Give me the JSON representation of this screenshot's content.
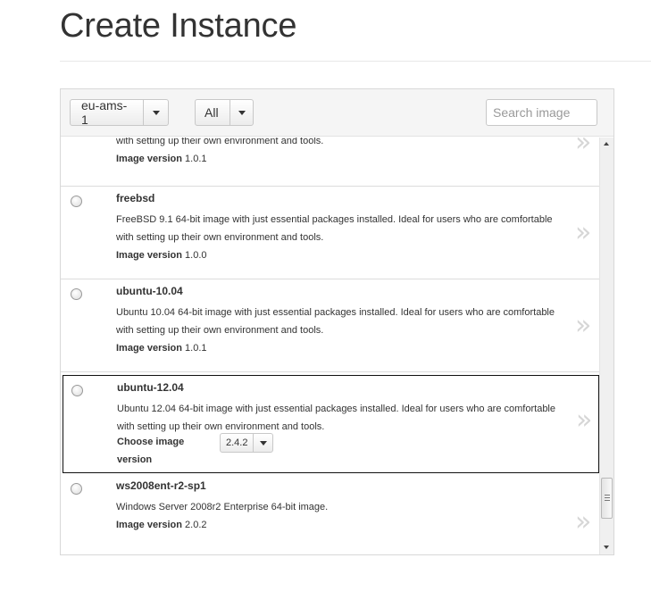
{
  "page": {
    "title": "Create Instance"
  },
  "toolbar": {
    "region_label": "eu-ams-1",
    "filter_label": "All",
    "search_placeholder": "Search image"
  },
  "version_label": "Image version",
  "choose_version_label": "Choose image version",
  "items": [
    {
      "name": "",
      "description": "with setting up their own environment and tools.",
      "version": "1.0.1",
      "selected": false
    },
    {
      "name": "freebsd",
      "description": "FreeBSD 9.1 64-bit image with just essential packages installed. Ideal for users who are comfortable with setting up their own environment and tools.",
      "version": "1.0.0",
      "selected": false
    },
    {
      "name": "ubuntu-10.04",
      "description": "Ubuntu 10.04 64-bit image with just essential packages installed. Ideal for users who are comfortable with setting up their own environment and tools.",
      "version": "1.0.1",
      "selected": false
    },
    {
      "name": "ubuntu-12.04",
      "description": "Ubuntu 12.04 64-bit image with just essential packages installed. Ideal for users who are comfortable with setting up their own environment and tools.",
      "version": "2.4.2",
      "selected": true
    },
    {
      "name": "ws2008ent-r2-sp1",
      "description": "Windows Server 2008r2 Enterprise 64-bit image.",
      "version": "2.0.2",
      "selected": false
    }
  ],
  "icons": {
    "chevron": "»",
    "caret": "caret-down-icon",
    "radio": "radio-button"
  }
}
